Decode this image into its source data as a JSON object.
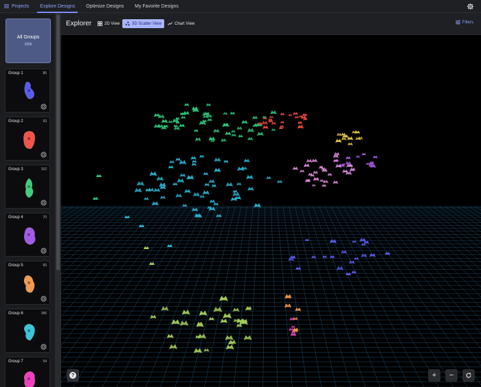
{
  "nav": {
    "home_label": "Projects",
    "tabs": [
      {
        "label": "Explore Designs",
        "active": true
      },
      {
        "label": "Optimize Designs",
        "active": false
      },
      {
        "label": "My Favorite Designs",
        "active": false
      }
    ]
  },
  "sidebar": {
    "all_groups": {
      "label": "All Groups",
      "count": "1055"
    },
    "groups": [
      {
        "name": "Group 1",
        "count": "85",
        "color": "#5a5cf0"
      },
      {
        "name": "Group 2",
        "count": "93",
        "color": "#f0544a"
      },
      {
        "name": "Group 3",
        "count": "152",
        "color": "#3fcf7c"
      },
      {
        "name": "Group 4",
        "count": "70",
        "color": "#a35ae6"
      },
      {
        "name": "Group 5",
        "count": "65",
        "color": "#f09a52"
      },
      {
        "name": "Group 6",
        "count": "186",
        "color": "#3cc4d9"
      },
      {
        "name": "Group 7",
        "count": "54",
        "color": "#ef40c0"
      }
    ]
  },
  "explorer": {
    "title": "Explorer",
    "views": [
      {
        "label": "2D View",
        "active": false
      },
      {
        "label": "3D Scatter View",
        "active": true
      },
      {
        "label": "Chart View",
        "active": false
      }
    ],
    "filters_label": "Filters"
  },
  "controls": {
    "zoom_in": "+",
    "zoom_out": "−",
    "reset_icon": "refresh-icon",
    "help": "?"
  },
  "colors": {
    "accent": "#8fa3ff",
    "green": "#2fc77a",
    "red": "#ef4a3f",
    "yellow": "#e8c64a",
    "violet": "#a95ee8",
    "pink": "#e48de0",
    "cyan": "#2ab6d4",
    "blue": "#5a5cf0",
    "lime": "#a7d15a",
    "orange": "#f29a4a",
    "magenta": "#ef40c0"
  }
}
